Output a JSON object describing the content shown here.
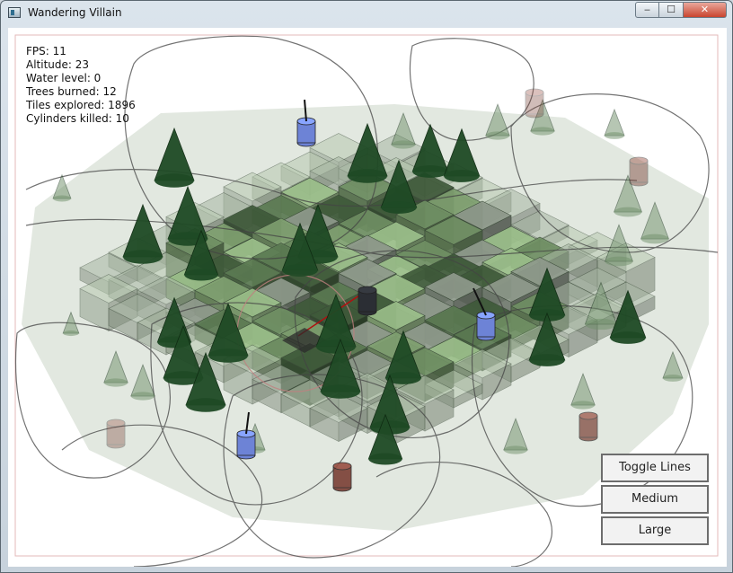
{
  "window": {
    "title": "Wandering Villain",
    "controls": {
      "minimize": "‒",
      "maximize": "☐",
      "close": "✕"
    }
  },
  "hud": {
    "fps": "FPS: 11",
    "altitude": "Altitude: 23",
    "water_level": "Water level: 0",
    "trees_burned": "Trees burned: 12",
    "tiles_explored": "Tiles explored: 1896",
    "cylinders_killed": "Cylinders killed: 10"
  },
  "buttons": {
    "toggle_lines": "Toggle Lines",
    "medium": "Medium",
    "large": "Large"
  },
  "colors": {
    "ground_light": "#9bbf8a",
    "ground_mid": "#6f8f63",
    "ground_dark": "#3f5a3a",
    "stone": "#8f9a8c",
    "tree": "#1f4a25",
    "cylinder_blue": "#6d83d6",
    "cylinder_dark": "#2b2e34",
    "cylinder_red": "#7a3f35"
  },
  "icons": [
    "window-app-icon",
    "minimize-icon",
    "maximize-icon",
    "close-icon"
  ]
}
